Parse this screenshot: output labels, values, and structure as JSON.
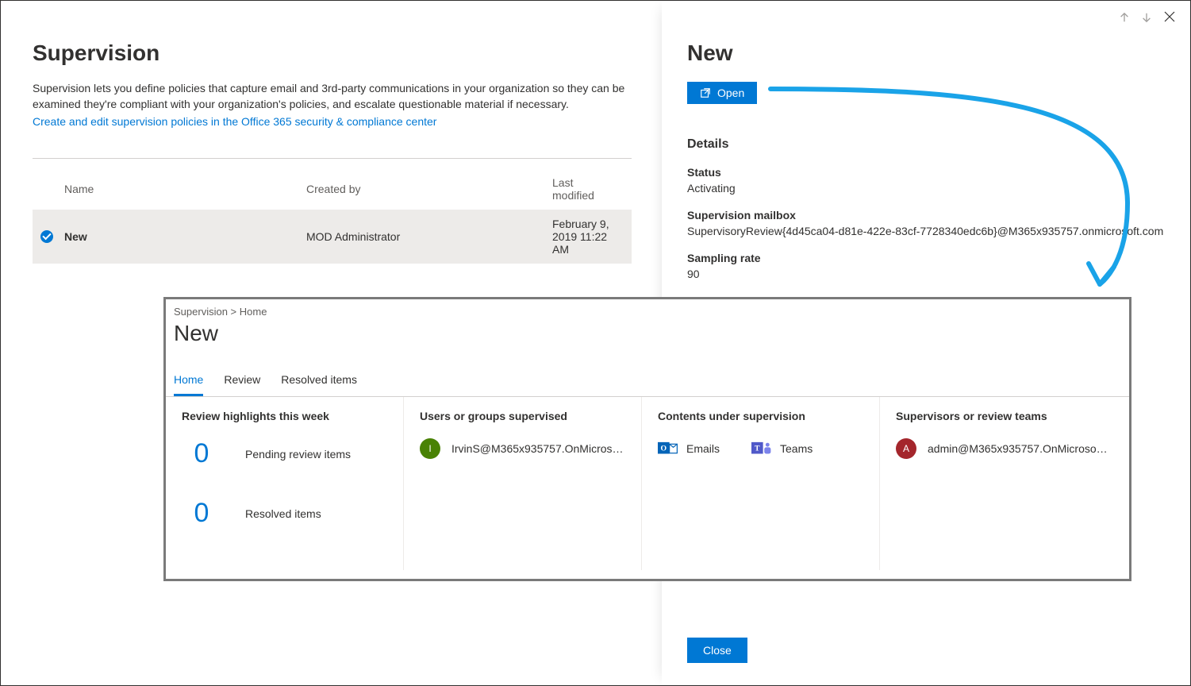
{
  "main": {
    "title": "Supervision",
    "intro": "Supervision lets you define policies that capture email and 3rd-party communications in your organization so they can be examined they're compliant with your organization's policies, and escalate questionable material if necessary.",
    "link": "Create and edit supervision policies in the Office 365 security & compliance center",
    "columns": {
      "name": "Name",
      "created": "Created by",
      "modified": "Last modified"
    },
    "row": {
      "name": "New",
      "created": "MOD Administrator",
      "modified": "February 9, 2019 11:22 AM"
    }
  },
  "flyout": {
    "title": "New",
    "open": "Open",
    "details": "Details",
    "status_label": "Status",
    "status": "Activating",
    "mailbox_label": "Supervision mailbox",
    "mailbox": "SupervisoryReview{4d45ca04-d81e-422e-83cf-7728340edc6b}@M365x935757.onmicrosoft.com",
    "rate_label": "Sampling rate",
    "rate": "90",
    "close": "Close"
  },
  "overlay": {
    "breadcrumb": "Supervision > Home",
    "title": "New",
    "tabs": {
      "home": "Home",
      "review": "Review",
      "resolved": "Resolved items"
    },
    "panel1": {
      "header": "Review highlights this week",
      "pending_count": "0",
      "pending_label": "Pending review items",
      "resolved_count": "0",
      "resolved_label": "Resolved items"
    },
    "panel2": {
      "header": "Users or groups supervised",
      "avatar_initial": "I",
      "user": "IrvinS@M365x935757.OnMicrosoft...."
    },
    "panel3": {
      "header": "Contents under supervision",
      "emails": "Emails",
      "teams": "Teams"
    },
    "panel4": {
      "header": "Supervisors or review teams",
      "avatar_initial": "A",
      "user": "admin@M365x935757.OnMicrosoft...."
    }
  }
}
